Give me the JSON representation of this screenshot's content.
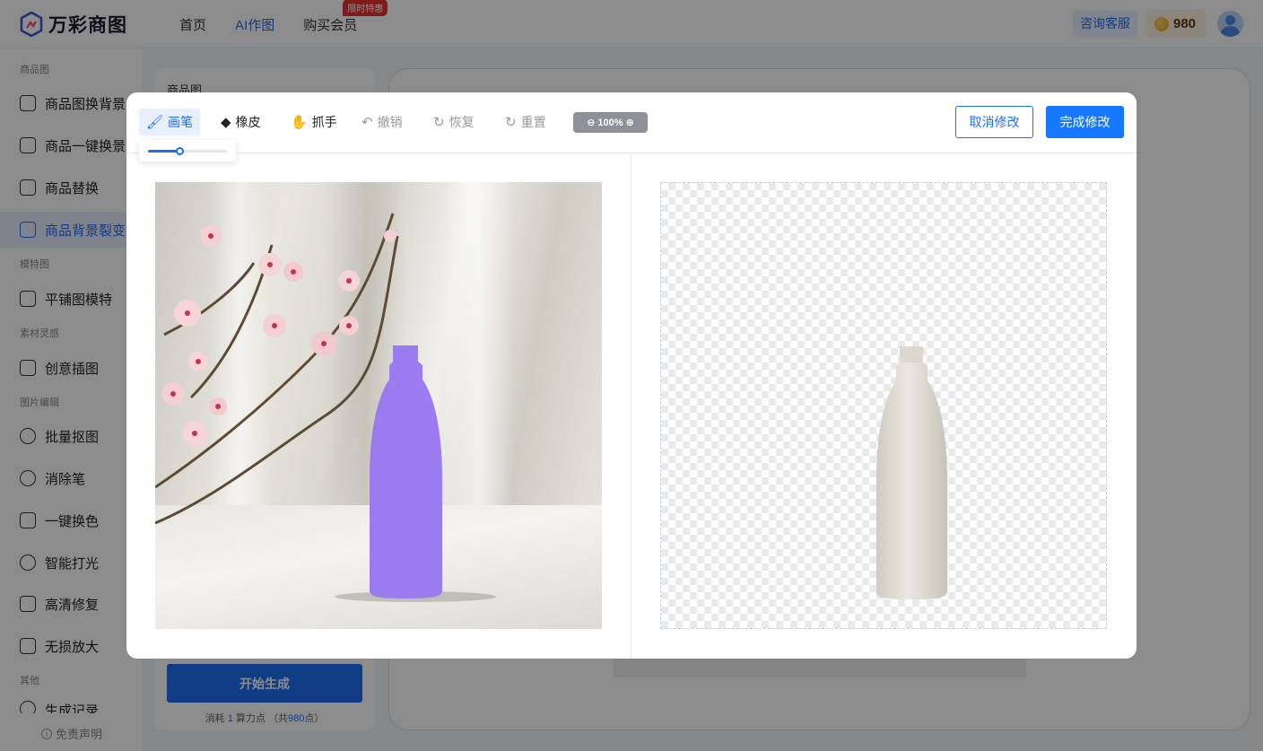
{
  "app": {
    "logo_text": "万彩商图"
  },
  "nav": {
    "items": [
      {
        "label": "首页"
      },
      {
        "label": "AI作图"
      },
      {
        "label": "购买会员"
      }
    ],
    "hot_tag": "限时特惠",
    "consult_label": "咨询客服",
    "coins": "980"
  },
  "sidebar": {
    "groups": {
      "product": "商品图",
      "model": "模特图",
      "inspiration": "素材灵感",
      "edit": "图片编辑",
      "other": "其他"
    },
    "items": [
      {
        "label": "商品图换背景"
      },
      {
        "label": "商品一键换景"
      },
      {
        "label": "商品替换"
      },
      {
        "label": "商品背景裂变"
      },
      {
        "label": "平铺图模特"
      },
      {
        "label": "创意插图"
      },
      {
        "label": "批量抠图"
      },
      {
        "label": "消除笔"
      },
      {
        "label": "一键换色"
      },
      {
        "label": "智能打光"
      },
      {
        "label": "高清修复"
      },
      {
        "label": "无损放大"
      },
      {
        "label": "生成记录"
      }
    ],
    "active_index": 3,
    "disclaimer": "免责声明"
  },
  "panel": {
    "title": "商品图",
    "generate_label": "开始生成",
    "cost_prefix": "消耗",
    "cost_value": "1",
    "cost_unit": "算力点",
    "total_prefix": "（共",
    "total_value": "980",
    "total_suffix": "点）"
  },
  "editor": {
    "tools": [
      {
        "label": "画笔",
        "icon": "brush-icon",
        "state": "active"
      },
      {
        "label": "橡皮",
        "icon": "eraser-icon",
        "state": "normal"
      },
      {
        "label": "抓手",
        "icon": "hand-icon",
        "state": "normal"
      },
      {
        "label": "撤销",
        "icon": "undo-icon",
        "state": "disabled"
      },
      {
        "label": "恢复",
        "icon": "redo-icon",
        "state": "disabled"
      },
      {
        "label": "重置",
        "icon": "reset-icon",
        "state": "disabled"
      }
    ],
    "zoom_label": "100%",
    "brush_size_fraction": 0.4,
    "cancel_label": "取消修改",
    "done_label": "完成修改"
  },
  "colors": {
    "accent": "#1e6ef5",
    "primary_button": "#1677ff",
    "hot_tag": "#e8322e",
    "bottle_masked": "#9b7bf0",
    "bottle_original": "#e4e1da"
  }
}
